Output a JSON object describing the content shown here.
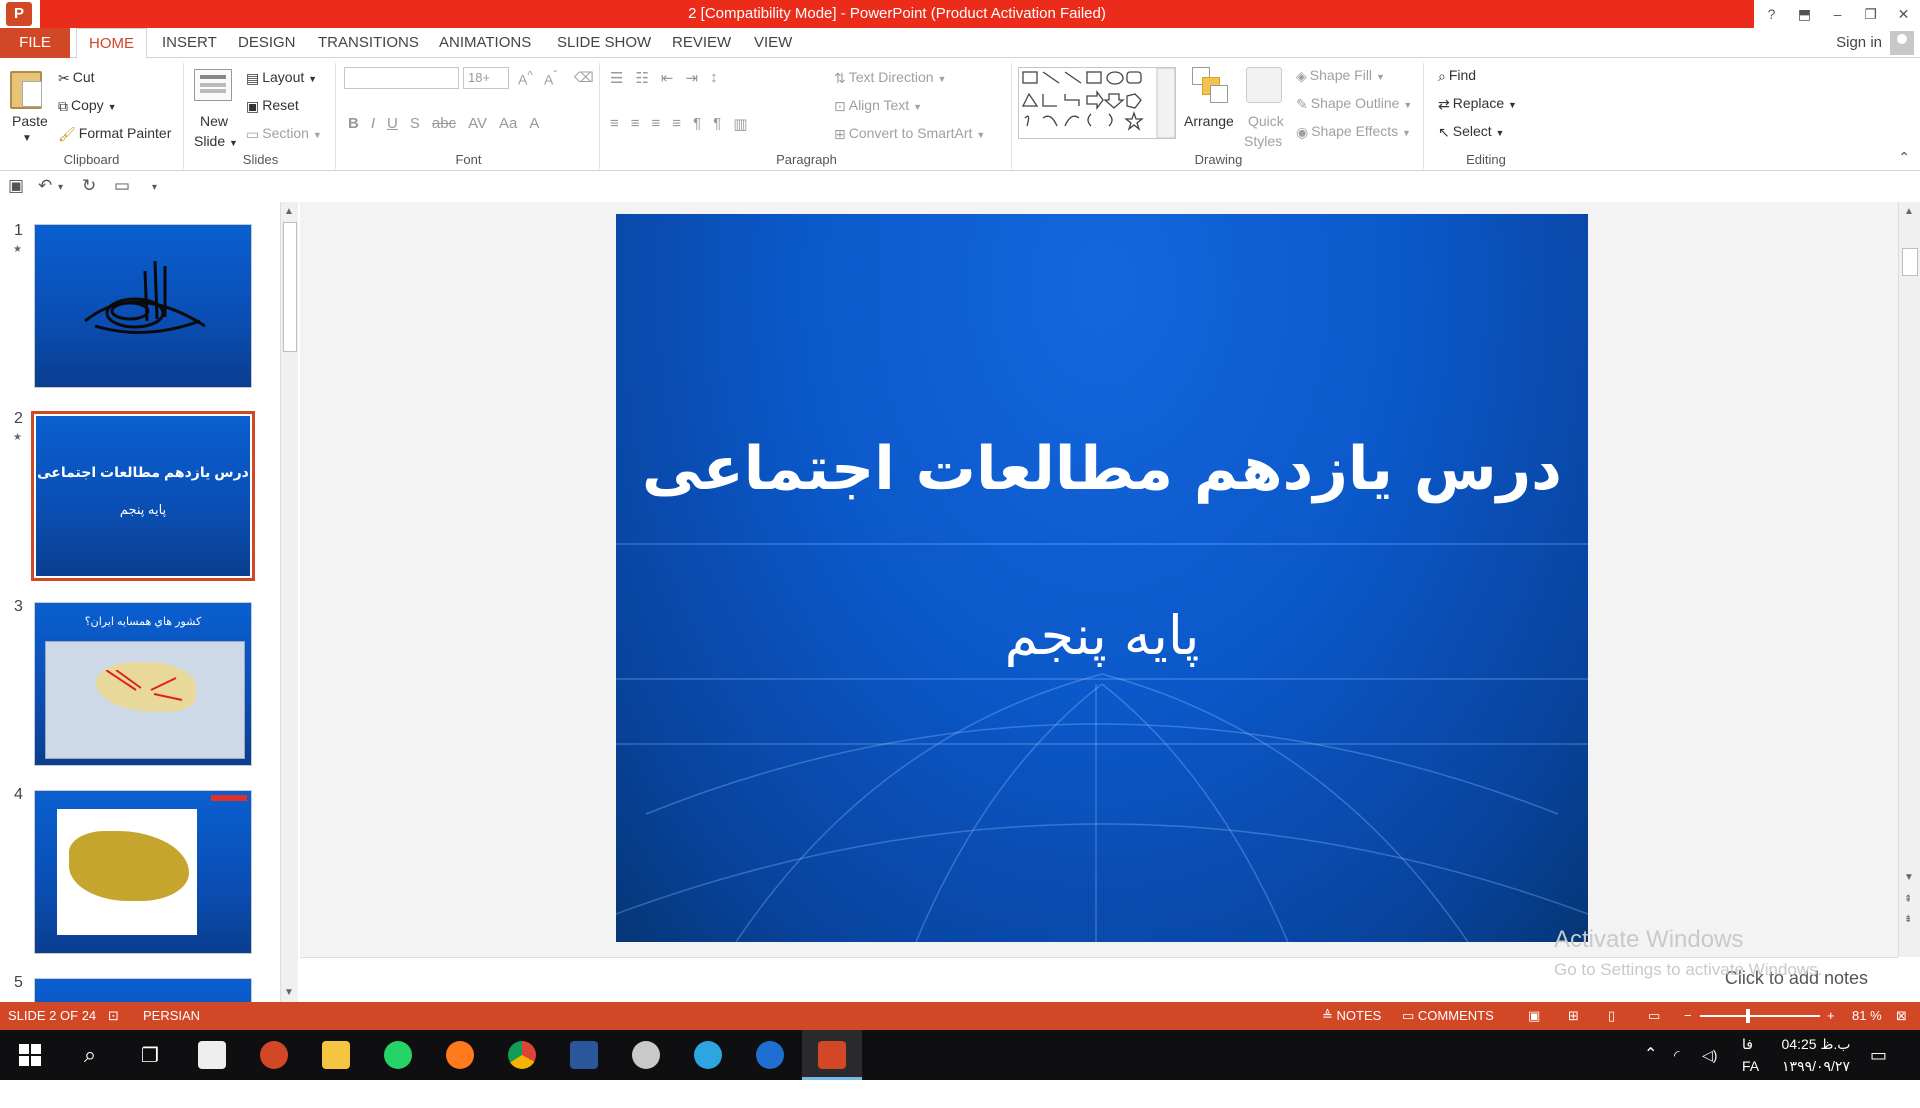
{
  "window": {
    "title": "2 [Compatibility Mode] -  PowerPoint (Product Activation Failed)",
    "app_icon_letter": "P",
    "controls": [
      "?",
      "⬒",
      "–",
      "❐",
      "✕"
    ]
  },
  "tabs": [
    "FILE",
    "HOME",
    "INSERT",
    "DESIGN",
    "TRANSITIONS",
    "ANIMATIONS",
    "SLIDE SHOW",
    "REVIEW",
    "VIEW"
  ],
  "active_tab": "HOME",
  "signin": "Sign in",
  "ribbon": {
    "clipboard": {
      "label": "Clipboard",
      "paste": "Paste",
      "cut": "Cut",
      "copy": "Copy",
      "format_painter": "Format Painter"
    },
    "slides": {
      "label": "Slides",
      "new_slide_1": "New",
      "new_slide_2": "Slide",
      "layout": "Layout",
      "reset": "Reset",
      "section": "Section"
    },
    "font": {
      "label": "Font",
      "font_name": "",
      "font_size": "18+"
    },
    "paragraph": {
      "label": "Paragraph",
      "text_direction": "Text Direction",
      "align_text": "Align Text",
      "convert_smartart": "Convert to SmartArt"
    },
    "drawing": {
      "label": "Drawing",
      "arrange": "Arrange",
      "quick_styles_1": "Quick",
      "quick_styles_2": "Styles",
      "shape_fill": "Shape Fill",
      "shape_outline": "Shape Outline",
      "shape_effects": "Shape Effects"
    },
    "editing": {
      "label": "Editing",
      "find": "Find",
      "replace": "Replace",
      "select": "Select"
    }
  },
  "thumbnails": [
    {
      "num": "1",
      "title": "",
      "subtitle": ""
    },
    {
      "num": "2",
      "title": "درس یازدهم مطالعات اجتماعی",
      "subtitle": "پایه پنجم"
    },
    {
      "num": "3",
      "caption": "کشور هاي همسايه ايران؟"
    },
    {
      "num": "4",
      "caption": ""
    },
    {
      "num": "5",
      "caption": ""
    }
  ],
  "slide": {
    "title": "درس یازدهم مطالعات اجتماعی",
    "subtitle": "پایه پنجم"
  },
  "notes_placeholder": "Click to add notes",
  "watermark": {
    "line1": "Activate Windows",
    "line2": "Go to Settings to activate Windows."
  },
  "status": {
    "slide_info": "SLIDE 2 OF 24",
    "language": "PERSIAN",
    "notes": "NOTES",
    "comments": "COMMENTS",
    "zoom": "81 %"
  },
  "taskbar": {
    "lang": "FA",
    "lang2": "فا",
    "time": "04:25 ب.ظ",
    "date": "۱۳۹۹/۰۹/۲۷"
  },
  "colors": {
    "accent": "#d24726",
    "title_red": "#ec2c1b",
    "slide_blue": "#0b58c9"
  }
}
